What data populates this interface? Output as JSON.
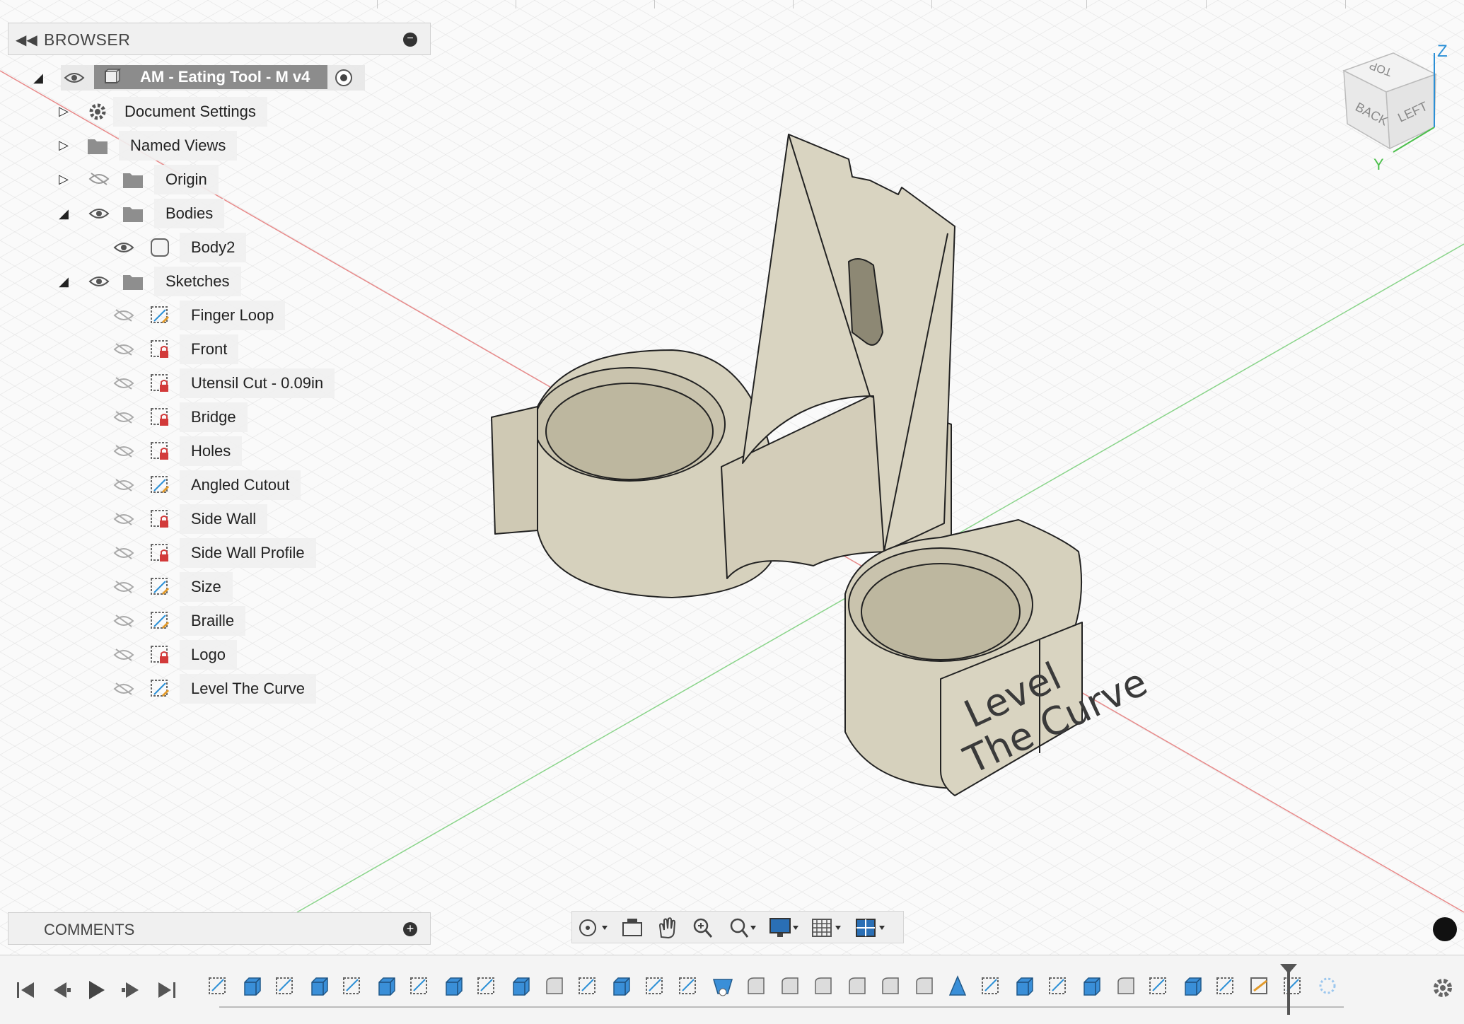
{
  "browser": {
    "title": "BROWSER",
    "root": {
      "label": "AM - Eating Tool - M v4"
    },
    "items": [
      {
        "label": "Document Settings",
        "icon": "gear-icon"
      },
      {
        "label": "Named Views",
        "icon": "folder-icon"
      },
      {
        "label": "Origin",
        "icon": "folder-icon",
        "hidden": true
      },
      {
        "label": "Bodies",
        "icon": "folder-icon"
      },
      {
        "label": "Body2",
        "icon": "body-icon"
      },
      {
        "label": "Sketches",
        "icon": "folder-icon"
      }
    ],
    "sketches": [
      {
        "label": "Finger Loop",
        "locked": false
      },
      {
        "label": "Front",
        "locked": true
      },
      {
        "label": "Utensil Cut - 0.09in",
        "locked": true
      },
      {
        "label": "Bridge",
        "locked": true
      },
      {
        "label": "Holes",
        "locked": true
      },
      {
        "label": "Angled Cutout",
        "locked": false
      },
      {
        "label": "Side Wall",
        "locked": true
      },
      {
        "label": "Side Wall Profile",
        "locked": true
      },
      {
        "label": "Size",
        "locked": false
      },
      {
        "label": "Braille",
        "locked": false
      },
      {
        "label": "Logo",
        "locked": true
      },
      {
        "label": "Level The Curve",
        "locked": false
      }
    ]
  },
  "comments": {
    "title": "COMMENTS"
  },
  "viewcube": {
    "top": "TOP",
    "back": "BACK",
    "left": "LEFT",
    "axis_z": "Z",
    "axis_y": "Y"
  },
  "model": {
    "engraving_line1": "Level",
    "engraving_line2": "The Curve"
  },
  "colors": {
    "body": "#dcd7c5",
    "body_shade": "#c9c3ad",
    "accent_blue": "#2a8fd6",
    "lock_red": "#d23a3a"
  }
}
